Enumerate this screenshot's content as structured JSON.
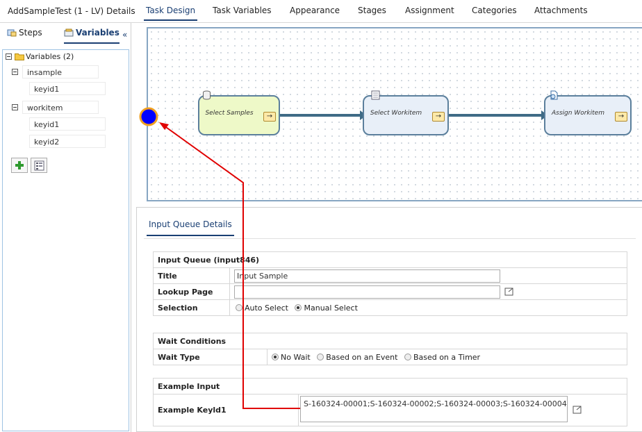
{
  "header": {
    "title": "AddSampleTest (1 - LV) Details",
    "tabs": [
      {
        "label": "Task Design",
        "active": true
      },
      {
        "label": "Task Variables"
      },
      {
        "label": "Appearance"
      },
      {
        "label": "Stages"
      },
      {
        "label": "Assignment"
      },
      {
        "label": "Categories"
      },
      {
        "label": "Attachments"
      }
    ]
  },
  "left_panel": {
    "tabs": [
      {
        "label": "Steps",
        "icon": "steps-icon"
      },
      {
        "label": "Variables",
        "icon": "variables-icon",
        "active": true
      }
    ],
    "collapse_glyph": "«",
    "tree": {
      "root_label": "Variables (2)",
      "variables": [
        {
          "name": "insample",
          "keys": [
            "keyid1"
          ]
        },
        {
          "name": "workitem",
          "keys": [
            "keyid1",
            "keyid2"
          ]
        }
      ]
    }
  },
  "canvas": {
    "nodes": [
      {
        "label": "Select Samples",
        "icon": "database-icon",
        "color": "#eef9c8"
      },
      {
        "label": "Select Workitem",
        "icon": "list-icon",
        "color": "#e8eff8"
      },
      {
        "label": "Assign Workitem",
        "icon": "assign-icon",
        "color": "#e8eff8"
      }
    ],
    "arrow_glyph": "→",
    "start_color": "#0000ff",
    "annotation_color": "#e00000"
  },
  "details": {
    "tab_label": "Input Queue Details",
    "input_queue": {
      "header": "Input Queue (input846)",
      "title_label": "Title",
      "title_value": "Input Sample",
      "lookup_label": "Lookup Page",
      "lookup_value": "",
      "selection_label": "Selection",
      "selection_options": [
        {
          "label": "Auto Select",
          "checked": false
        },
        {
          "label": "Manual Select",
          "checked": true
        }
      ]
    },
    "wait": {
      "header": "Wait Conditions",
      "type_label": "Wait Type",
      "options": [
        {
          "label": "No Wait",
          "checked": true
        },
        {
          "label": "Based on an Event",
          "checked": false
        },
        {
          "label": "Based on a Timer",
          "checked": false
        }
      ]
    },
    "example": {
      "header": "Example Input",
      "keyid_label": "Example Keyld1",
      "keyid_value": "S-160324-00001;S-160324-00002;S-160324-00003;S-160324-00004"
    }
  }
}
